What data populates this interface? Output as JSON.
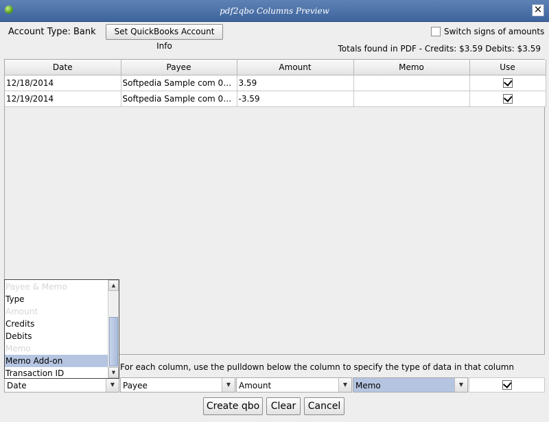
{
  "window": {
    "title": "pdf2qbo Columns Preview",
    "close_glyph": "✕",
    "icon": "app-icon",
    "close_icon": "close-icon"
  },
  "account": {
    "label": "Account Type: Bank",
    "set_button": "Set QuickBooks Account Info"
  },
  "switch_signs": {
    "label": "Switch signs of amounts",
    "checked": false
  },
  "totals": "Totals found in PDF - Credits: $3.59  Debits: $3.59",
  "table": {
    "headers": [
      "Date",
      "Payee",
      "Amount",
      "Memo",
      "Use"
    ],
    "rows": [
      {
        "date": "12/18/2014",
        "payee": "Softpedia Sample com 0278...",
        "amount": "3.59",
        "memo": "",
        "use": true
      },
      {
        "date": "12/19/2014",
        "payee": "Softpedia Sample com 0278...",
        "amount": "-3.59",
        "memo": "",
        "use": true
      }
    ]
  },
  "instructions": "For each column, use the pulldown below the column to specify the type of data in that column",
  "dropdown_options": [
    "Payee & Memo",
    "Type",
    "Amount",
    "Credits",
    "Debits",
    "Memo",
    "Memo Add-on",
    "Transaction ID"
  ],
  "highlighted_option": "Memo Add-on",
  "column_selectors": {
    "date": "Date",
    "payee": "Payee",
    "amount": "Amount",
    "memo": "Memo"
  },
  "use_all_checked": true,
  "buttons": {
    "create": "Create qbo",
    "clear": "Clear",
    "cancel": "Cancel"
  },
  "colors": {
    "titlebar": "#4a6fa5",
    "highlight": "#b5c5e1"
  }
}
